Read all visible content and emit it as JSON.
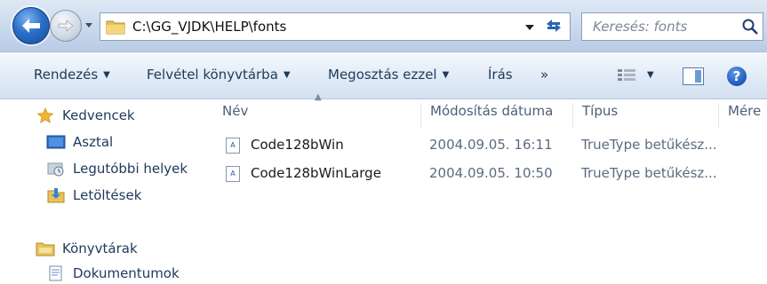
{
  "window": {
    "path": "C:\\GG_VJDK\\HELP\\fonts",
    "search_placeholder": "Keresés: fonts"
  },
  "toolbar": {
    "organize": "Rendezés",
    "add_to_library": "Felvétel könyvtárba",
    "share_with": "Megosztás ezzel",
    "burn": "Írás",
    "more": "»"
  },
  "navpane": {
    "favorites": "Kedvencek",
    "desktop": "Asztal",
    "recent_places": "Legutóbbi helyek",
    "downloads": "Letöltések",
    "libraries": "Könyvtárak",
    "documents": "Dokumentumok"
  },
  "columns": {
    "name": "Név",
    "date_modified": "Módosítás dátuma",
    "type": "Típus",
    "size": "Mére"
  },
  "files": [
    {
      "name": "Code128bWin",
      "date": "2004.09.05. 16:11",
      "type": "TrueType betűkész..."
    },
    {
      "name": "Code128bWinLarge",
      "date": "2004.09.05. 10:50",
      "type": "TrueType betűkész..."
    }
  ],
  "icons": {
    "back": "back-arrow-icon",
    "forward": "forward-arrow-icon",
    "folder": "folder-icon",
    "refresh": "refresh-icon",
    "search": "search-icon",
    "font_file": "font-file-icon",
    "help": "help-icon"
  },
  "colors": {
    "accent": "#2a6fc9",
    "toolbar_text": "#1e395b",
    "secondary_text": "#5c6c80"
  }
}
